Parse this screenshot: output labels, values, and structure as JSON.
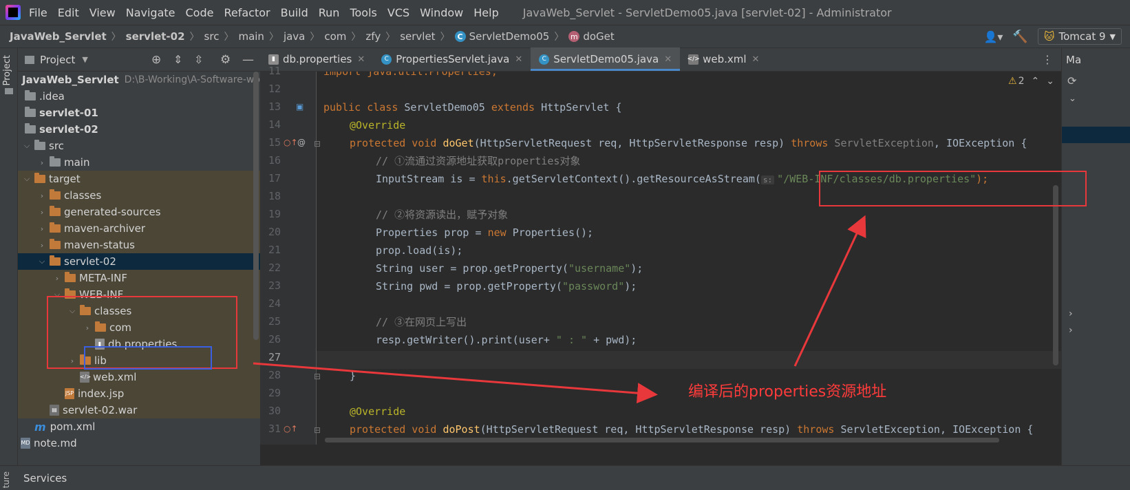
{
  "menu": [
    "File",
    "Edit",
    "View",
    "Navigate",
    "Code",
    "Refactor",
    "Build",
    "Run",
    "Tools",
    "VCS",
    "Window",
    "Help"
  ],
  "window_title": "JavaWeb_Servlet - ServletDemo05.java [servlet-02] - Administrator",
  "breadcrumb": [
    "JavaWeb_Servlet",
    "servlet-02",
    "src",
    "main",
    "java",
    "com",
    "zfy",
    "servlet",
    "ServletDemo05",
    "doGet"
  ],
  "run_config": "Tomcat 9",
  "left_strip_tab": "Project",
  "project_panel": {
    "title": "Project"
  },
  "tree": [
    {
      "label": "JavaWeb_Servlet",
      "path": "D:\\B-Working\\A-Software-work"
    },
    {
      "label": ".idea"
    },
    {
      "label": "servlet-01"
    },
    {
      "label": "servlet-02"
    },
    {
      "label": "src"
    },
    {
      "label": "main"
    },
    {
      "label": "target"
    },
    {
      "label": "classes"
    },
    {
      "label": "generated-sources"
    },
    {
      "label": "maven-archiver"
    },
    {
      "label": "maven-status"
    },
    {
      "label": "servlet-02"
    },
    {
      "label": "META-INF"
    },
    {
      "label": "WEB-INF"
    },
    {
      "label": "classes"
    },
    {
      "label": "com"
    },
    {
      "label": "db.properties"
    },
    {
      "label": "lib"
    },
    {
      "label": "web.xml"
    },
    {
      "label": "index.jsp"
    },
    {
      "label": "servlet-02.war"
    },
    {
      "label": "pom.xml"
    },
    {
      "label": "note.md"
    }
  ],
  "tabs": [
    "db.properties",
    "PropertiesServlet.java",
    "ServletDemo05.java",
    "web.xml"
  ],
  "warnings": "2",
  "line_numbers": [
    "11",
    "12",
    "13",
    "14",
    "15",
    "16",
    "17",
    "18",
    "19",
    "20",
    "21",
    "22",
    "23",
    "24",
    "25",
    "26",
    "27",
    "28",
    "29",
    "30",
    "31"
  ],
  "code": {
    "l11": "import java.util.Properties;",
    "l13a": "public class ",
    "l13b": "ServletDemo05 ",
    "l13c": "extends ",
    "l13d": "HttpServlet {",
    "l14": "@Override",
    "l15a": "protected void ",
    "l15b": "doGet",
    "l15c": "(HttpServletRequest req, HttpServletResponse resp) ",
    "l15d": "throws ",
    "l15e": "ServletException",
    "l15f": ", IOException {",
    "l16": "// ①流通过资源地址获取properties对象",
    "l17a": "InputStream is = ",
    "l17b": "this",
    "l17c": ".getServletContext().getResourceAsStream(",
    "l17hint": "s:",
    "l17d": "\"/WEB-INF/classes/db.properties\"",
    "l17e": ");",
    "l19": "// ②将资源读出，赋予对象",
    "l20a": "Properties prop = ",
    "l20b": "new ",
    "l20c": "Properties();",
    "l21": "prop.load(is);",
    "l22a": "String user = prop.getProperty(",
    "l22b": "\"username\"",
    "l22c": ");",
    "l23a": "String pwd = prop.getProperty(",
    "l23b": "\"password\"",
    "l23c": ");",
    "l25": "// ③在网页上写出",
    "l26a": "resp.getWriter().print(user+ ",
    "l26b": "\" : \"",
    "l26c": " + pwd);",
    "l28": "}",
    "l30": "@Override",
    "l31a": "protected void ",
    "l31b": "doPost",
    "l31c": "(HttpServletRequest req, HttpServletResponse resp) ",
    "l31d": "throws ",
    "l31e": "ServletException, IOException {"
  },
  "right_panel_label": "Ma",
  "bottom_left_label": "ture",
  "services_label": "Services",
  "annotation_text": "编译后的properties资源地址",
  "colors": {
    "annotation_red": "#e8383b",
    "highlight_blue": "#3a5fe0"
  }
}
